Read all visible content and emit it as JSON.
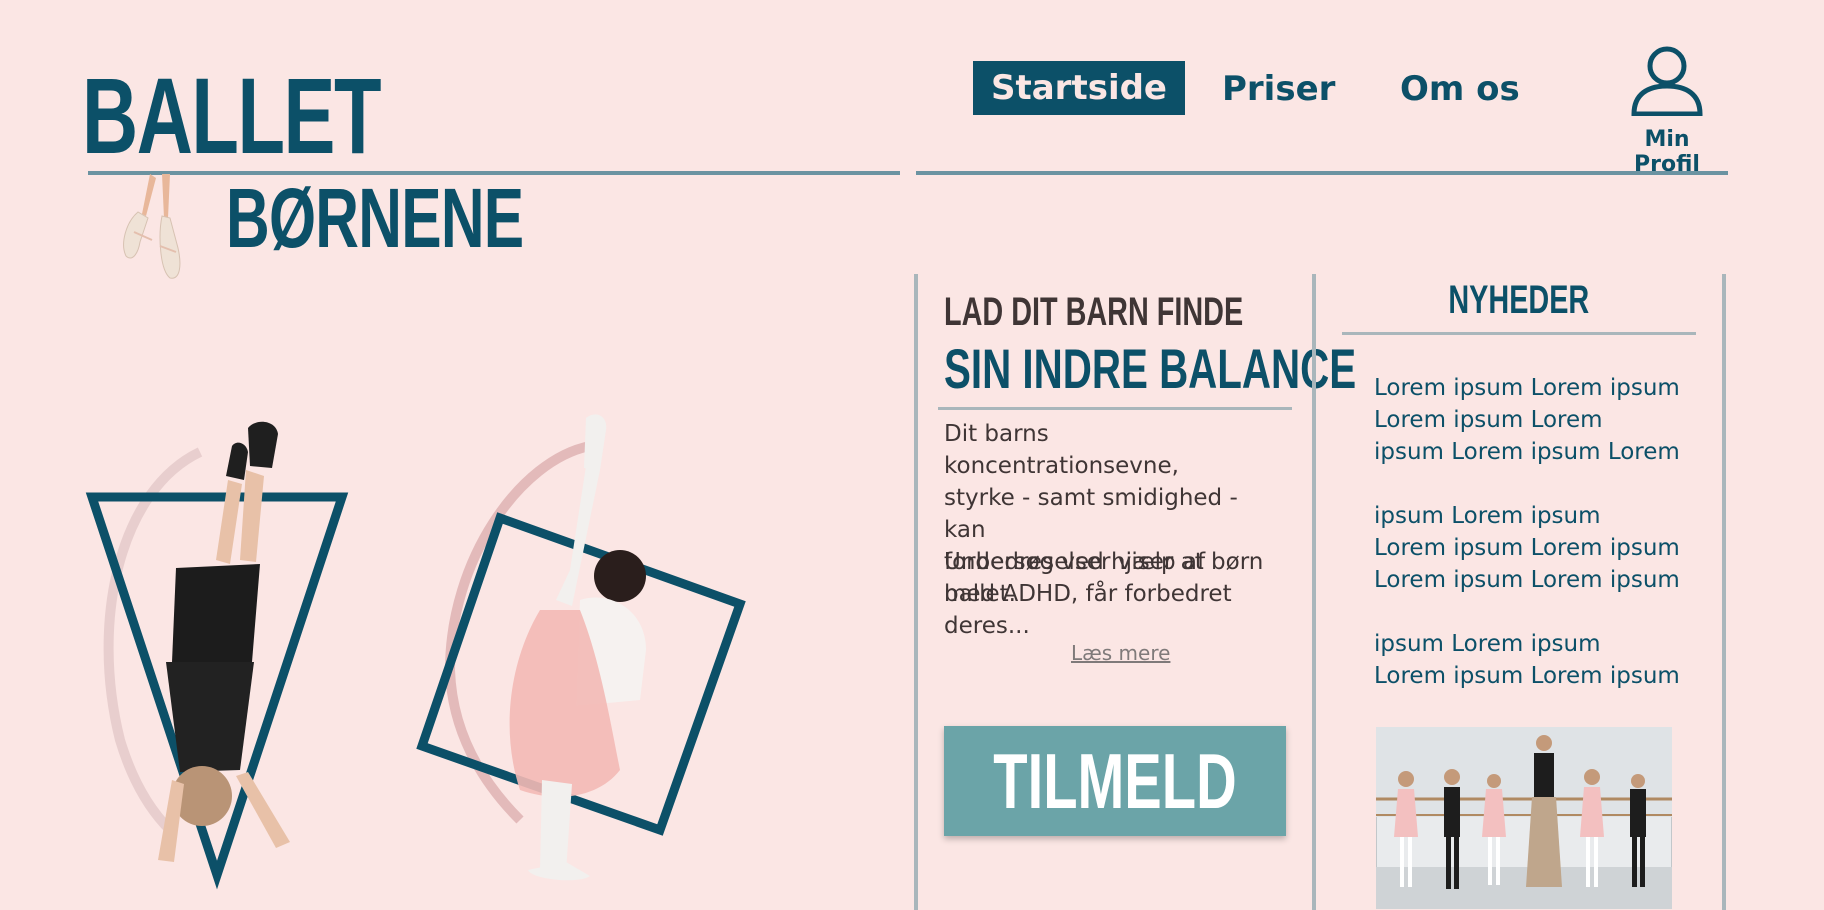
{
  "logo": {
    "line1": "BALLET",
    "line2": "BØRNENE"
  },
  "nav": {
    "items": [
      {
        "label": "Startside",
        "active": true
      },
      {
        "label": "Priser",
        "active": false
      },
      {
        "label": "Om os",
        "active": false
      }
    ],
    "profile_label": "Min Profil"
  },
  "hero": {
    "tagline_small": "LAD DIT BARN FINDE",
    "tagline_big": "SIN INDRE BALANCE",
    "paragraph1_lines": [
      "Dit barns koncentrationsevne,",
      "styrke - samt smidighed - kan",
      "forbedres ved hjælp af ballet."
    ],
    "paragraph2_lines": [
      "Undersøgelser viser at børn",
      "med ADHD, får forbedret",
      "deres..."
    ],
    "read_more": "Læs mere",
    "cta_label": "TILMELD"
  },
  "news": {
    "title": "NYHEDER",
    "blocks": [
      [
        "Lorem ipsum Lorem ipsum",
        "Lorem ipsum Lorem",
        "ipsum Lorem ipsum Lorem"
      ],
      [
        "ipsum Lorem ipsum",
        "Lorem ipsum Lorem ipsum",
        "Lorem ipsum Lorem ipsum"
      ],
      [
        "ipsum Lorem ipsum",
        "Lorem ipsum Lorem ipsum"
      ]
    ]
  },
  "colors": {
    "background": "#fbe6e4",
    "primary": "#0c5068",
    "cta": "#6ba4a8",
    "text_dark": "#3f3535"
  },
  "icons": [
    "ballet-shoes-icon",
    "user-profile-icon"
  ]
}
